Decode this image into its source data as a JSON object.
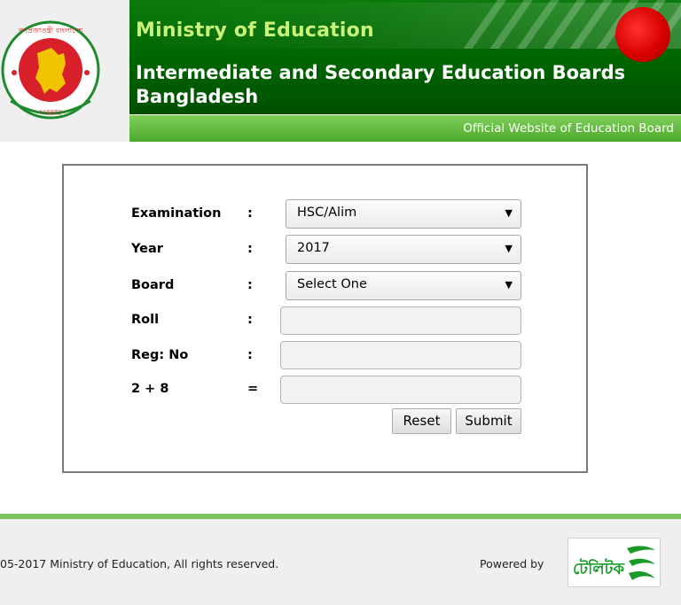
{
  "header": {
    "ministry_title": "Ministry of Education",
    "boards_title": "Intermediate and Secondary Education Boards Bangladesh",
    "subtitle": "Official Website of Education Board",
    "seal_top_text": "গণপ্রজাতন্ত্রী বাংলাদেশ",
    "seal_bottom_text": "সরকার"
  },
  "form": {
    "fields": [
      {
        "label": "Examination",
        "colon": ":",
        "type": "select",
        "value": "HSC/Alim"
      },
      {
        "label": "Year",
        "colon": ":",
        "type": "select",
        "value": "2017"
      },
      {
        "label": "Board",
        "colon": ":",
        "type": "select",
        "value": "Select One"
      },
      {
        "label": "Roll",
        "colon": ":",
        "type": "input",
        "value": ""
      },
      {
        "label": "Reg: No",
        "colon": ":",
        "type": "input",
        "value": ""
      },
      {
        "label": "2 + 8",
        "colon": "=",
        "type": "input",
        "value": ""
      }
    ],
    "reset_label": "Reset",
    "submit_label": "Submit"
  },
  "footer": {
    "copyright": "05-2017 Ministry of Education, All rights reserved.",
    "powered_by": "Powered by",
    "partner_logo_text": "টেলিটক"
  },
  "colors": {
    "header_green": "#006400",
    "ministry_text": "#c8f27a",
    "subheader_green": "#4ea92b",
    "footer_line": "#7dc35b"
  }
}
